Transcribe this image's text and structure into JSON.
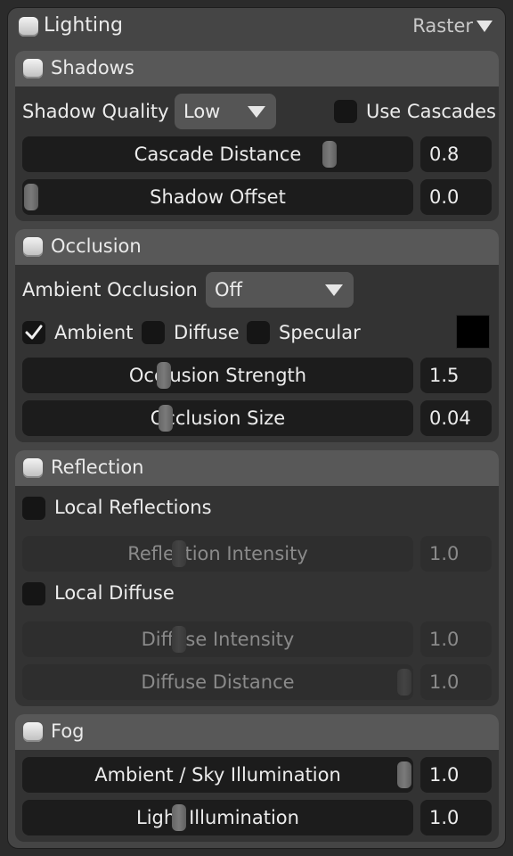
{
  "panel": {
    "title": "Lighting",
    "mode_label": "Raster"
  },
  "shadows": {
    "title": "Shadows",
    "quality_label": "Shadow Quality",
    "quality_value": "Low",
    "use_cascades_label": "Use Cascades",
    "use_cascades": false,
    "cascade_distance_label": "Cascade Distance",
    "cascade_distance_value": "0.8",
    "shadow_offset_label": "Shadow Offset",
    "shadow_offset_value": "0.0"
  },
  "occlusion": {
    "title": "Occlusion",
    "ambient_occlusion_label": "Ambient Occlusion",
    "ambient_occlusion_value": "Off",
    "ambient_label": "Ambient",
    "ambient": true,
    "diffuse_label": "Diffuse",
    "diffuse": false,
    "specular_label": "Specular",
    "specular": false,
    "color": "#000000",
    "strength_label": "Occlusion Strength",
    "strength_value": "1.5",
    "size_label": "Occlusion Size",
    "size_value": "0.04"
  },
  "reflection": {
    "title": "Reflection",
    "local_reflections_label": "Local Reflections",
    "local_reflections": false,
    "intensity_label": "Reflection Intensity",
    "intensity_value": "1.0",
    "local_diffuse_label": "Local Diffuse",
    "local_diffuse": false,
    "diffuse_intensity_label": "Diffuse Intensity",
    "diffuse_intensity_value": "1.0",
    "diffuse_distance_label": "Diffuse Distance",
    "diffuse_distance_value": "1.0"
  },
  "fog": {
    "title": "Fog",
    "ambient_sky_label": "Ambient / Sky Illumination",
    "ambient_sky_value": "1.0",
    "light_label": "Light Illumination",
    "light_value": "1.0"
  }
}
